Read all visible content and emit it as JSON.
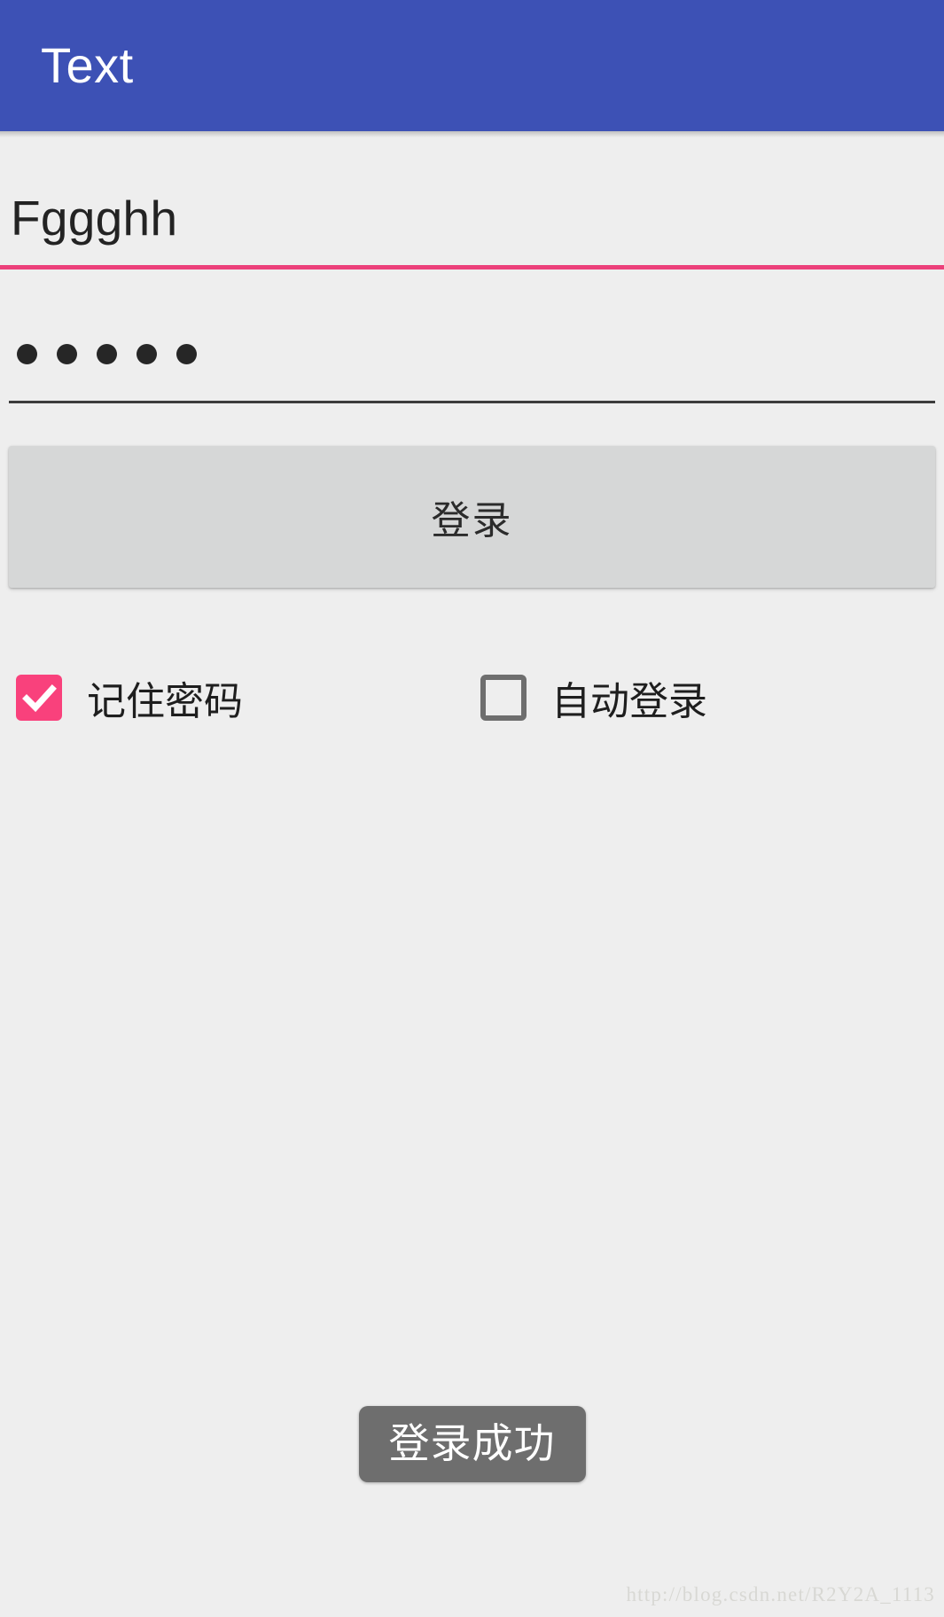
{
  "appbar": {
    "title": "Text",
    "background_color": "#3d51b5",
    "title_color": "#ffffff"
  },
  "form": {
    "username_field": {
      "value": "Fggghh",
      "placeholder": "",
      "underline_color": "#ec407a",
      "state": "focused"
    },
    "password_field": {
      "value": "•••••",
      "masked_char_count": 5,
      "placeholder": "",
      "underline_color": "#3c3c3c",
      "state": "idle"
    },
    "login_button": {
      "label": "登录",
      "background_color": "#d6d7d7"
    },
    "checkboxes": [
      {
        "label": "记住密码",
        "checked": true,
        "accent_color": "#f9417c",
        "icon": "checkmark-icon"
      },
      {
        "label": "自动登录",
        "checked": false,
        "border_color": "#6e6e6e",
        "icon": "empty-box-icon"
      }
    ]
  },
  "toast": {
    "message": "登录成功",
    "background_color": "#6e6e6e",
    "text_color": "#ffffff"
  },
  "watermark": {
    "text": "http://blog.csdn.net/R2Y2A_1113",
    "color": "#d8d8d4"
  },
  "screen": {
    "background_color": "#eeeeee"
  }
}
